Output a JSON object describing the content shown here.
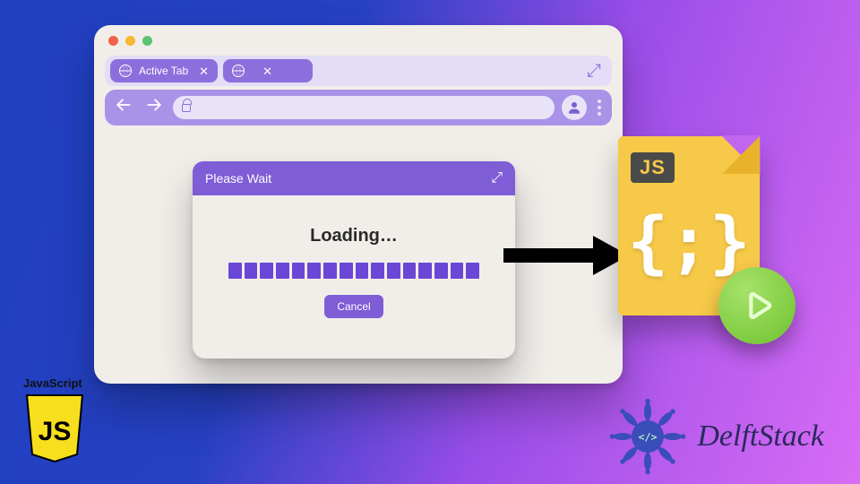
{
  "browser": {
    "tabs": [
      {
        "label": "Active Tab"
      },
      {
        "label": ""
      }
    ]
  },
  "dialog": {
    "title": "Please Wait",
    "loading": "Loading…",
    "cancel": "Cancel",
    "progress_segments": 16
  },
  "jsfile": {
    "label": "JS",
    "code": "{;}"
  },
  "badges": {
    "javascript": "JavaScript",
    "js_shield": "JS"
  },
  "brand": {
    "name": "DelftStack"
  },
  "colors": {
    "purple": "#7e5dd6",
    "purple_light": "#a993e8",
    "yellow": "#f7c948",
    "green": "#6ec22e",
    "brand_blue": "#3a4db8"
  }
}
